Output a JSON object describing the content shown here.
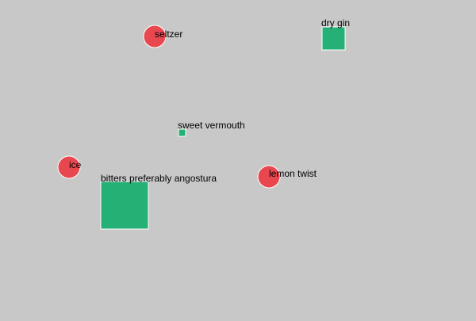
{
  "colors": {
    "background": "#c8c8c8",
    "square": "#25b076",
    "circle": "#e8474f",
    "stroke": "#ffffff",
    "label": "#000000"
  },
  "nodes": [
    {
      "id": "seltzer",
      "shape": "circle",
      "icon": "red-circle",
      "label": "seltzer"
    },
    {
      "id": "dry-gin",
      "shape": "square",
      "icon": "green-square",
      "label": "dry gin"
    },
    {
      "id": "sweet-vermouth",
      "shape": "square",
      "icon": "green-square",
      "label": "sweet vermouth"
    },
    {
      "id": "ice",
      "shape": "circle",
      "icon": "red-circle",
      "label": "ice"
    },
    {
      "id": "lemon-twist",
      "shape": "circle",
      "icon": "red-circle",
      "label": "lemon twist"
    },
    {
      "id": "bitters",
      "shape": "square",
      "icon": "green-square",
      "label": "bitters preferably angostura"
    }
  ]
}
